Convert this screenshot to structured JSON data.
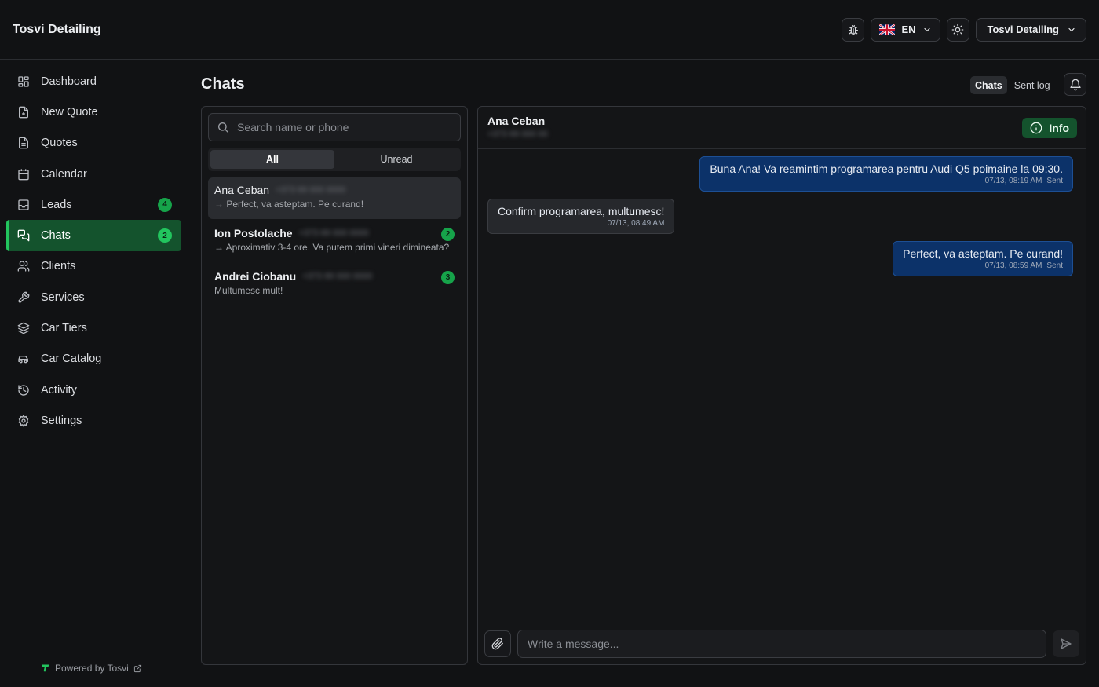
{
  "app": {
    "title": "Tosvi Detailing"
  },
  "topbar": {
    "language": "EN",
    "account": "Tosvi Detailing",
    "icons": [
      "bug-icon",
      "uk-flag-icon",
      "sun-icon",
      "chevron-down-icon"
    ]
  },
  "sidebar": {
    "items": [
      {
        "label": "Dashboard",
        "icon": "dashboard-icon"
      },
      {
        "label": "New Quote",
        "icon": "file-plus-icon"
      },
      {
        "label": "Quotes",
        "icon": "file-text-icon"
      },
      {
        "label": "Calendar",
        "icon": "calendar-icon"
      },
      {
        "label": "Leads",
        "icon": "inbox-icon",
        "badge": "4"
      },
      {
        "label": "Chats",
        "icon": "chats-icon",
        "badge": "2",
        "active": true
      },
      {
        "label": "Clients",
        "icon": "users-icon"
      },
      {
        "label": "Services",
        "icon": "wrench-icon"
      },
      {
        "label": "Car Tiers",
        "icon": "layers-icon"
      },
      {
        "label": "Car Catalog",
        "icon": "car-icon"
      },
      {
        "label": "Activity",
        "icon": "history-icon"
      },
      {
        "label": "Settings",
        "icon": "gear-icon"
      }
    ],
    "powered_by": "Powered by Tosvi"
  },
  "main": {
    "title": "Chats",
    "view_tabs": [
      {
        "label": "Chats",
        "active": true
      },
      {
        "label": "Sent log",
        "active": false
      }
    ]
  },
  "list": {
    "search_placeholder": "Search name or phone",
    "filters": [
      {
        "label": "All",
        "active": true
      },
      {
        "label": "Unread",
        "active": false
      }
    ],
    "conversations": [
      {
        "name": "Ana Ceban",
        "phone": "+373 69 000 0000",
        "preview": "→ Perfect, va asteptam. Pe curand!",
        "selected": true,
        "unread": ""
      },
      {
        "name": "Ion Postolache",
        "phone": "+373 69 000 0000",
        "preview": "→ Aproximativ 3-4 ore. Va putem primi vineri dimineata?",
        "selected": false,
        "unread": "2"
      },
      {
        "name": "Andrei Ciobanu",
        "phone": "+373 69 000 0000",
        "preview": "Multumesc mult!",
        "selected": false,
        "unread": "3"
      }
    ]
  },
  "chat": {
    "contact_name": "Ana Ceban",
    "contact_phone": "+373 69 000 00",
    "info_label": "Info",
    "messages": [
      {
        "direction": "out",
        "text": "Buna Ana! Va reamintim programarea pentru Audi Q5 poimaine la 09:30.",
        "time": "07/13, 08:19 AM",
        "status": "Sent"
      },
      {
        "direction": "in",
        "text": "Confirm programarea, multumesc!",
        "time": "07/13, 08:49 AM",
        "status": ""
      },
      {
        "direction": "out",
        "text": "Perfect, va asteptam. Pe curand!",
        "time": "07/13, 08:59 AM",
        "status": "Sent"
      }
    ],
    "composer_placeholder": "Write a message..."
  },
  "colors": {
    "accent": "#22c55e",
    "active_nav_bg": "#14532d",
    "outgoing_bubble": "#0c3269",
    "incoming_bubble": "#26282c",
    "background": "#111214"
  }
}
